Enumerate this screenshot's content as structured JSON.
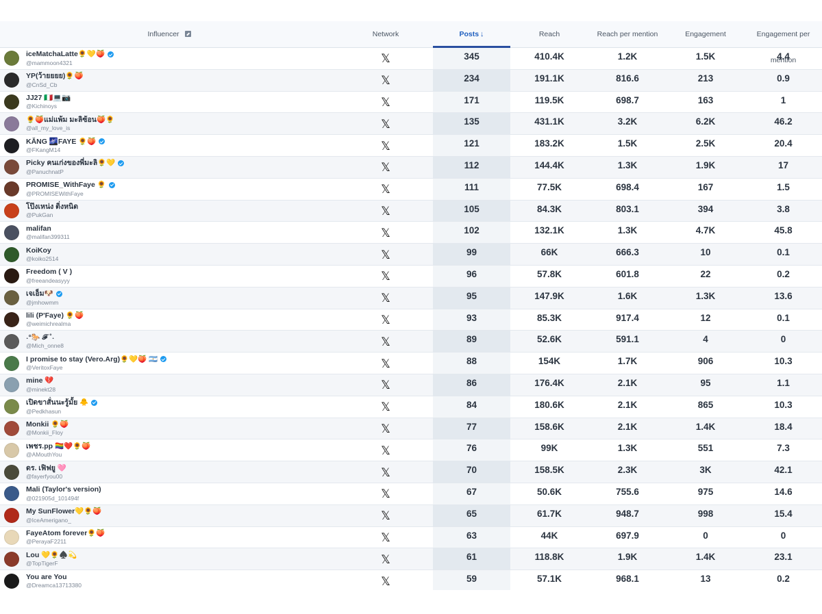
{
  "header": {
    "influencer": "Influencer",
    "network": "Network",
    "posts": "Posts",
    "sort_arrow": "↓",
    "reach": "Reach",
    "reach_per_mention": "Reach per mention",
    "engagement": "Engagement",
    "engagement_per_mention": "Engagement per mention"
  },
  "network_icon": "𝕏",
  "rows": [
    {
      "name": "iceMatchaLatte🌻💛🍑",
      "handle": "@mammoon4321",
      "verified": true,
      "posts": "345",
      "reach": "410.4K",
      "rpm": "1.2K",
      "eng": "1.5K",
      "epm": "4.4",
      "avatar": "#6b7b3a"
    },
    {
      "name": "YP(ว้ายยยย)🌻🍑",
      "handle": "@CnSd_Cb",
      "verified": false,
      "posts": "234",
      "reach": "191.1K",
      "rpm": "816.6",
      "eng": "213",
      "epm": "0.9",
      "avatar": "#2a2a2a"
    },
    {
      "name": "JJ27 🇮🇹💻📷",
      "handle": "@Kichinoys",
      "verified": false,
      "posts": "171",
      "reach": "119.5K",
      "rpm": "698.7",
      "eng": "163",
      "epm": "1",
      "avatar": "#3b3a1e"
    },
    {
      "name": "🌻🍑แม่แพ้ม มะลิซ้อน🍑🌻",
      "handle": "@all_my_love_is",
      "verified": false,
      "posts": "135",
      "reach": "431.1K",
      "rpm": "3.2K",
      "eng": "6.2K",
      "epm": "46.2",
      "avatar": "#8a7a9a"
    },
    {
      "name": "KĂNG 🌌FAYE 🌻🍑",
      "handle": "@FKangM14",
      "verified": true,
      "posts": "121",
      "reach": "183.2K",
      "rpm": "1.5K",
      "eng": "2.5K",
      "epm": "20.4",
      "avatar": "#1e1e22"
    },
    {
      "name": "Picky คนเก่งของพี่มะลิ🌻💛",
      "handle": "@PanuchnatP",
      "verified": true,
      "posts": "112",
      "reach": "144.4K",
      "rpm": "1.3K",
      "eng": "1.9K",
      "epm": "17",
      "avatar": "#7a4a3a"
    },
    {
      "name": "PROMISE_WithFaye 🌻",
      "handle": "@PROMISEWithFaye",
      "verified": true,
      "posts": "111",
      "reach": "77.5K",
      "rpm": "698.4",
      "eng": "167",
      "epm": "1.5",
      "avatar": "#6a3a2a"
    },
    {
      "name": "โป๊งเหน่ง ติ่งหนิด",
      "handle": "@PukGan",
      "verified": false,
      "posts": "105",
      "reach": "84.3K",
      "rpm": "803.1",
      "eng": "394",
      "epm": "3.8",
      "avatar": "#c8401a"
    },
    {
      "name": "malifan",
      "handle": "@malifan399311",
      "verified": false,
      "posts": "102",
      "reach": "132.1K",
      "rpm": "1.3K",
      "eng": "4.7K",
      "epm": "45.8",
      "avatar": "#4a5060"
    },
    {
      "name": "KoiKoy",
      "handle": "@koiko2514",
      "verified": false,
      "posts": "99",
      "reach": "66K",
      "rpm": "666.3",
      "eng": "10",
      "epm": "0.1",
      "avatar": "#2f5a2a"
    },
    {
      "name": "Freedom ( V )",
      "handle": "@freeandeasyyy",
      "verified": false,
      "posts": "96",
      "reach": "57.8K",
      "rpm": "601.8",
      "eng": "22",
      "epm": "0.2",
      "avatar": "#2a1a12"
    },
    {
      "name": "เจเอ็ม🐶",
      "handle": "@jmhowmm",
      "verified": true,
      "posts": "95",
      "reach": "147.9K",
      "rpm": "1.6K",
      "eng": "1.3K",
      "epm": "13.6",
      "avatar": "#6a6040"
    },
    {
      "name": "lili (P'Faye) 🌻🍑",
      "handle": "@weimichrealma",
      "verified": false,
      "posts": "93",
      "reach": "85.3K",
      "rpm": "917.4",
      "eng": "12",
      "epm": "0.1",
      "avatar": "#3a2418"
    },
    {
      "name": "˖°🐎 𝓕 ˚˖",
      "handle": "@Mich_onne8",
      "verified": false,
      "posts": "89",
      "reach": "52.6K",
      "rpm": "591.1",
      "eng": "4",
      "epm": "0",
      "avatar": "#5a5a5a"
    },
    {
      "name": "I promise to stay (Vero.Arg)🌻💛🍑 🇦🇷",
      "handle": "@VeritoxFaye",
      "verified": true,
      "posts": "88",
      "reach": "154K",
      "rpm": "1.7K",
      "eng": "906",
      "epm": "10.3",
      "avatar": "#4a7a4a"
    },
    {
      "name": "mine 💔",
      "handle": "@minekt28",
      "verified": false,
      "posts": "86",
      "reach": "176.4K",
      "rpm": "2.1K",
      "eng": "95",
      "epm": "1.1",
      "avatar": "#8aa0b0"
    },
    {
      "name": "เปิดขาสั่นนะรู้มั้ย 🐥",
      "handle": "@Pedkhasun",
      "verified": true,
      "posts": "84",
      "reach": "180.6K",
      "rpm": "2.1K",
      "eng": "865",
      "epm": "10.3",
      "avatar": "#7a8a4a"
    },
    {
      "name": "Monkii 🌻🍑",
      "handle": "@Monkii_Floy",
      "verified": false,
      "posts": "77",
      "reach": "158.6K",
      "rpm": "2.1K",
      "eng": "1.4K",
      "epm": "18.4",
      "avatar": "#a04a3a"
    },
    {
      "name": "เพชร.pp 🏳️‍🌈❤️🌻🍑",
      "handle": "@AMouthYou",
      "verified": false,
      "posts": "76",
      "reach": "99K",
      "rpm": "1.3K",
      "eng": "551",
      "epm": "7.3",
      "avatar": "#d8c8a8"
    },
    {
      "name": "ดร. เฟิฟยู 🩷",
      "handle": "@fayerfyou00",
      "verified": false,
      "posts": "70",
      "reach": "158.5K",
      "rpm": "2.3K",
      "eng": "3K",
      "epm": "42.1",
      "avatar": "#4a4a3a"
    },
    {
      "name": "Mali (Taylor's version)",
      "handle": "@021905d_101494f",
      "verified": false,
      "posts": "67",
      "reach": "50.6K",
      "rpm": "755.6",
      "eng": "975",
      "epm": "14.6",
      "avatar": "#3a5a8a"
    },
    {
      "name": "My SunFlower💛🌻🍑",
      "handle": "@IceAmerigano_",
      "verified": false,
      "posts": "65",
      "reach": "61.7K",
      "rpm": "948.7",
      "eng": "998",
      "epm": "15.4",
      "avatar": "#b02a1a"
    },
    {
      "name": "FayeAtom forever🌻🍑",
      "handle": "@PerayaF2211",
      "verified": false,
      "posts": "63",
      "reach": "44K",
      "rpm": "697.9",
      "eng": "0",
      "epm": "0",
      "avatar": "#e8d8b8"
    },
    {
      "name": "Lou 💛🌻♠️💫",
      "handle": "@TopTigerF",
      "verified": false,
      "posts": "61",
      "reach": "118.8K",
      "rpm": "1.9K",
      "eng": "1.4K",
      "epm": "23.1",
      "avatar": "#8a3a2a"
    },
    {
      "name": "You are You",
      "handle": "@Dreamca13713380",
      "verified": false,
      "posts": "59",
      "reach": "57.1K",
      "rpm": "968.1",
      "eng": "13",
      "epm": "0.2",
      "avatar": "#1a1a1a"
    }
  ]
}
